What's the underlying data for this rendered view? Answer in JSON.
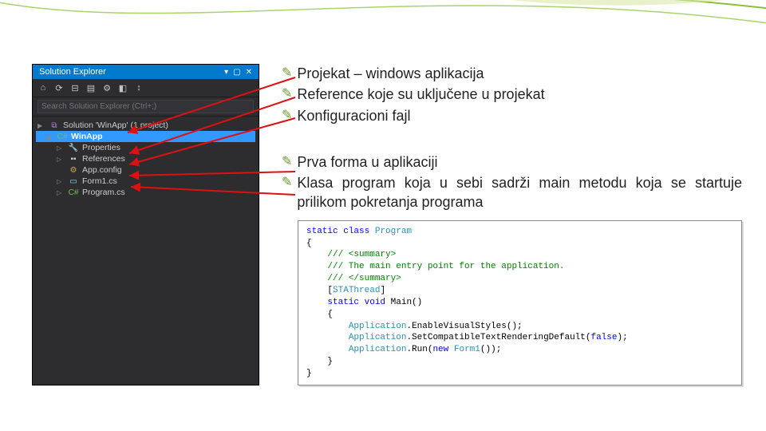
{
  "panel": {
    "title": "Solution Explorer",
    "search_placeholder": "Search Solution Explorer (Ctrl+;)",
    "solution_label": "Solution 'WinApp' (1 project)",
    "project_label": "WinApp",
    "items": {
      "properties": "Properties",
      "references": "References",
      "appconfig": "App.config",
      "form1": "Form1.cs",
      "program": "Program.cs"
    }
  },
  "bullets": {
    "b1": "Projekat – windows aplikacija",
    "b2": "Reference koje su uključene u projekat",
    "b3": "Konfiguracioni fajl",
    "b4": "Prva forma u aplikaciji",
    "b5": "Klasa program koja u sebi sadrži main metodu koja se startuje prilikom pokretanja programa"
  },
  "code": {
    "l1a": "static",
    "l1b": "class",
    "l1c": "Program",
    "l2": "{",
    "l3": "/// <summary>",
    "l4": "/// The main entry point for the application.",
    "l5": "/// </summary>",
    "l6a": "[",
    "l6b": "STAThread",
    "l6c": "]",
    "l7a": "static",
    "l7b": "void",
    "l7c": "Main()",
    "l8": "{",
    "l9a": "Application",
    "l9b": ".EnableVisualStyles();",
    "l10a": "Application",
    "l10b": ".SetCompatibleTextRenderingDefault(",
    "l10c": "false",
    "l10d": ");",
    "l11a": "Application",
    "l11b": ".Run(",
    "l11c": "new",
    "l11d": "Form1",
    "l11e": "());",
    "l12": "}",
    "l13": "}"
  }
}
